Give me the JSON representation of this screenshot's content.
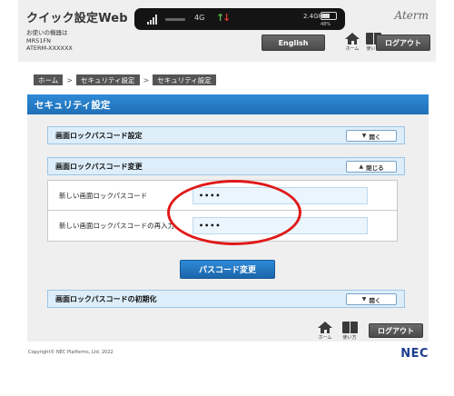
{
  "header": {
    "app_title": "クイック設定Web",
    "device_label": "お使いの機器は",
    "device_model": "MR51FN",
    "device_ssid": "ATERM-XXXXXX",
    "brand": "Aterm",
    "english_label": "English",
    "home_label": "ホーム",
    "manual_label": "使い方",
    "logout_label": "ログアウト"
  },
  "status_bar": {
    "network": "4G",
    "band": "2.4GHz",
    "battery_percent": "48%",
    "signal_icon": "signal-bars-icon",
    "traffic_icon": "up-down-arrows-icon",
    "battery_icon": "battery-icon",
    "colors": {
      "up_arrow": "#5ab84a",
      "down_arrow": "#e23a2a"
    }
  },
  "breadcrumb": {
    "items": [
      "ホーム",
      "セキュリティ設定",
      "セキュリティ設定"
    ],
    "separator": ">"
  },
  "page": {
    "section_title": "セキュリティ設定"
  },
  "sections": {
    "passcode_setting": {
      "title": "画面ロックパスコード設定",
      "toggle": "開く"
    },
    "passcode_change": {
      "title": "画面ロックパスコード変更",
      "toggle": "閉じる"
    },
    "passcode_reset": {
      "title": "画面ロックパスコードの初期化",
      "toggle": "開く"
    }
  },
  "form": {
    "new_passcode_label": "新しい画面ロックパスコード",
    "new_passcode_value": "••••",
    "confirm_passcode_label": "新しい画面ロックパスコードの再入力",
    "confirm_passcode_value": "••••",
    "submit_label": "パスコード変更"
  },
  "footer": {
    "home_label": "ホーム",
    "manual_label": "使い方",
    "logout_label": "ログアウト",
    "copyright": "Copyright© NEC Platforms, Ltd. 2022",
    "logo": "NEC"
  },
  "colors": {
    "accent_blue": "#1f6fb6",
    "annotation_red": "#e01919",
    "dark_button": "#4a4a4a",
    "nec_blue": "#1d3e8f"
  }
}
